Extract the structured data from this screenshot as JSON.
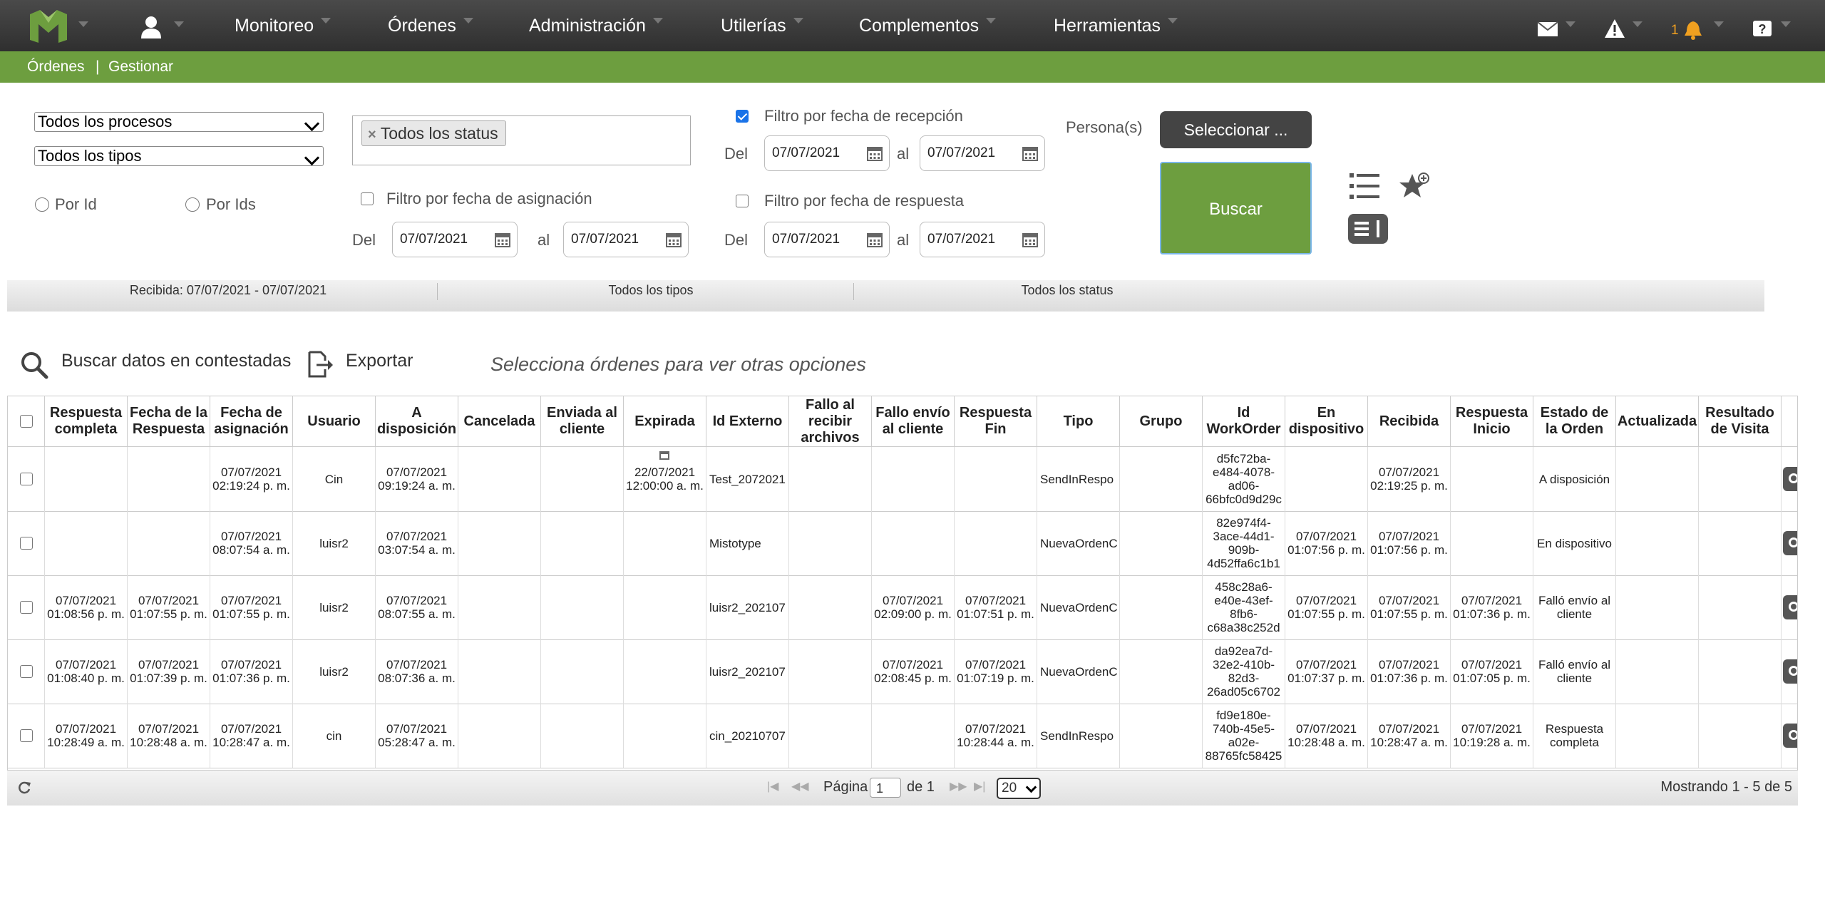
{
  "topnav": {
    "items": [
      "Monitoreo",
      "Órdenes",
      "Administración",
      "Utilerías",
      "Complementos",
      "Herramientas"
    ],
    "notification_count": "1"
  },
  "breadcrumb": {
    "section": "Órdenes",
    "separator": "|",
    "page": "Gestionar"
  },
  "filters": {
    "process_select": "Todos los procesos",
    "type_select": "Todos los tipos",
    "radio_por_id": "Por Id",
    "radio_por_ids": "Por Ids",
    "status_tag": "Todos los status",
    "assign_filter_label": "Filtro por fecha de asignación",
    "reception_filter_label": "Filtro por fecha de recepción",
    "response_filter_label": "Filtro por fecha de respuesta",
    "del_label": "Del",
    "al_label": "al",
    "date_value": "07/07/2021",
    "personas_label": "Persona(s)",
    "seleccionar_button": "Seleccionar ...",
    "buscar_button": "Buscar"
  },
  "summary": {
    "received": "Recibida: 07/07/2021 - 07/07/2021",
    "types": "Todos los tipos",
    "status": "Todos los status"
  },
  "toolbar": {
    "search_answered": "Buscar datos en contestadas",
    "export": "Exportar",
    "hint": "Selecciona órdenes para ver otras opciones"
  },
  "grid": {
    "columns": [
      "Respuesta completa",
      "Fecha de la Respuesta",
      "Fecha de asignación",
      "Usuario",
      "A disposición",
      "Cancelada",
      "Enviada al cliente",
      "Expirada",
      "Id Externo",
      "Fallo al recibir archivos",
      "Fallo envío al cliente",
      "Respuesta Fin",
      "Tipo",
      "Grupo",
      "Id WorkOrder",
      "En dispositivo",
      "Recibida",
      "Respuesta Inicio",
      "Estado de la Orden",
      "Actualizada",
      "Resultado de Visita"
    ],
    "rows": [
      [
        "",
        "",
        "07/07/2021 02:19:24 p. m.",
        "Cin",
        "07/07/2021 09:19:24 a. m.",
        "",
        "",
        "22/07/2021 12:00:00 a. m.",
        "Test_2072021",
        "",
        "",
        "",
        "SendInRespo",
        "",
        "d5fc72ba-e484-4078-ad06-66bfc0d9d29c",
        "",
        "07/07/2021 02:19:25 p. m.",
        "",
        "A disposición",
        "",
        ""
      ],
      [
        "",
        "",
        "07/07/2021 08:07:54 a. m.",
        "luisr2",
        "07/07/2021 03:07:54 a. m.",
        "",
        "",
        "",
        "Mistotype",
        "",
        "",
        "",
        "NuevaOrdenC",
        "",
        "82e974f4-3ace-44d1-909b-4d52ffa6c1b1",
        "07/07/2021 01:07:56 p. m.",
        "07/07/2021 01:07:56 p. m.",
        "",
        "En dispositivo",
        "",
        ""
      ],
      [
        "07/07/2021 01:08:56 p. m.",
        "07/07/2021 01:07:55 p. m.",
        "07/07/2021 01:07:55 p. m.",
        "luisr2",
        "07/07/2021 08:07:55 a. m.",
        "",
        "",
        "",
        "luisr2_202107",
        "",
        "07/07/2021 02:09:00 p. m.",
        "07/07/2021 01:07:51 p. m.",
        "NuevaOrdenC",
        "",
        "458c28a6-e40e-43ef-8fb6-c68a38c252d",
        "07/07/2021 01:07:55 p. m.",
        "07/07/2021 01:07:55 p. m.",
        "07/07/2021 01:07:36 p. m.",
        "Falló envío al cliente",
        "",
        ""
      ],
      [
        "07/07/2021 01:08:40 p. m.",
        "07/07/2021 01:07:39 p. m.",
        "07/07/2021 01:07:36 p. m.",
        "luisr2",
        "07/07/2021 08:07:36 a. m.",
        "",
        "",
        "",
        "luisr2_202107",
        "",
        "07/07/2021 02:08:45 p. m.",
        "07/07/2021 01:07:19 p. m.",
        "NuevaOrdenC",
        "",
        "da92ea7d-32e2-410b-82d3-26ad05c6702",
        "07/07/2021 01:07:37 p. m.",
        "07/07/2021 01:07:36 p. m.",
        "07/07/2021 01:07:05 p. m.",
        "Falló envío al cliente",
        "",
        ""
      ],
      [
        "07/07/2021 10:28:49 a. m.",
        "07/07/2021 10:28:48 a. m.",
        "07/07/2021 10:28:47 a. m.",
        "cin",
        "07/07/2021 05:28:47 a. m.",
        "",
        "",
        "",
        "cin_20210707",
        "",
        "",
        "07/07/2021 10:28:44 a. m.",
        "SendInRespo",
        "",
        "fd9e180e-740b-45e5-a02e-88765fc58425",
        "07/07/2021 10:28:48 a. m.",
        "07/07/2021 10:28:47 a. m.",
        "07/07/2021 10:19:28 a. m.",
        "Respuesta completa",
        "",
        ""
      ]
    ]
  },
  "pager": {
    "page_label": "Página",
    "page_value": "1",
    "of_label": "de 1",
    "page_size": "20",
    "showing": "Mostrando 1 - 5 de 5"
  },
  "colors": {
    "nav_bg": "#3a3a3a",
    "accent_green": "#6d9e3f",
    "alert_orange": "#f0a020"
  }
}
